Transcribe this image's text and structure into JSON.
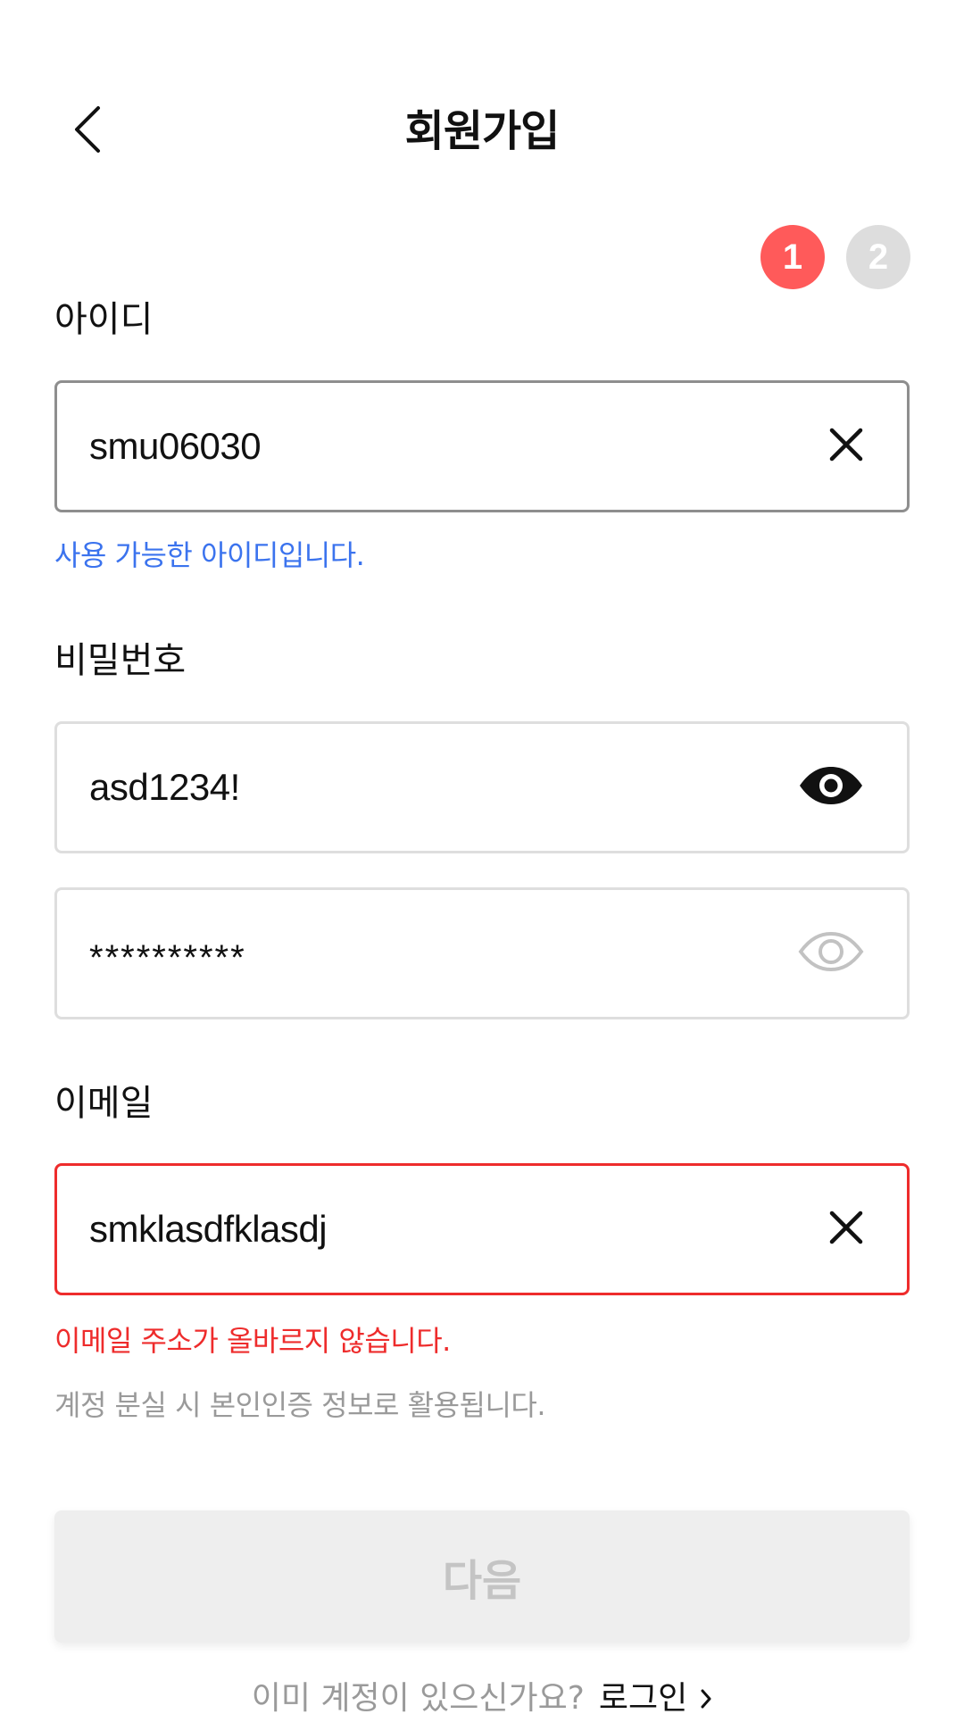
{
  "header": {
    "title": "회원가입",
    "back_icon": "chevron-left-icon"
  },
  "steps": [
    "1",
    "2"
  ],
  "active_step": "1",
  "id_field": {
    "label": "아이디",
    "value": "smu06030",
    "clear_icon": "close-icon",
    "message": "사용 가능한 아이디입니다."
  },
  "password_field": {
    "label": "비밀번호",
    "value": "asd1234!",
    "confirm_value": "**********",
    "visible_icon": "eye-icon",
    "hidden_icon": "eye-outline-icon"
  },
  "email_field": {
    "label": "이메일",
    "value": "smklasdfklasdj",
    "clear_icon": "close-icon",
    "error_message": "이메일 주소가 올바르지 않습니다.",
    "hint": "계정 분실 시 본인인증 정보로 활용됩니다."
  },
  "next_button": {
    "label": "다음",
    "enabled": false
  },
  "footer": {
    "prompt": "이미 계정이 있으신가요?",
    "link": "로그인"
  },
  "colors": {
    "accent": "#ff5a5a",
    "success": "#3b73ee",
    "error": "#ee2c2c",
    "hint": "#9a9a9a",
    "disabled_bg": "#eeeeee",
    "disabled_text": "#c4c4c4"
  }
}
